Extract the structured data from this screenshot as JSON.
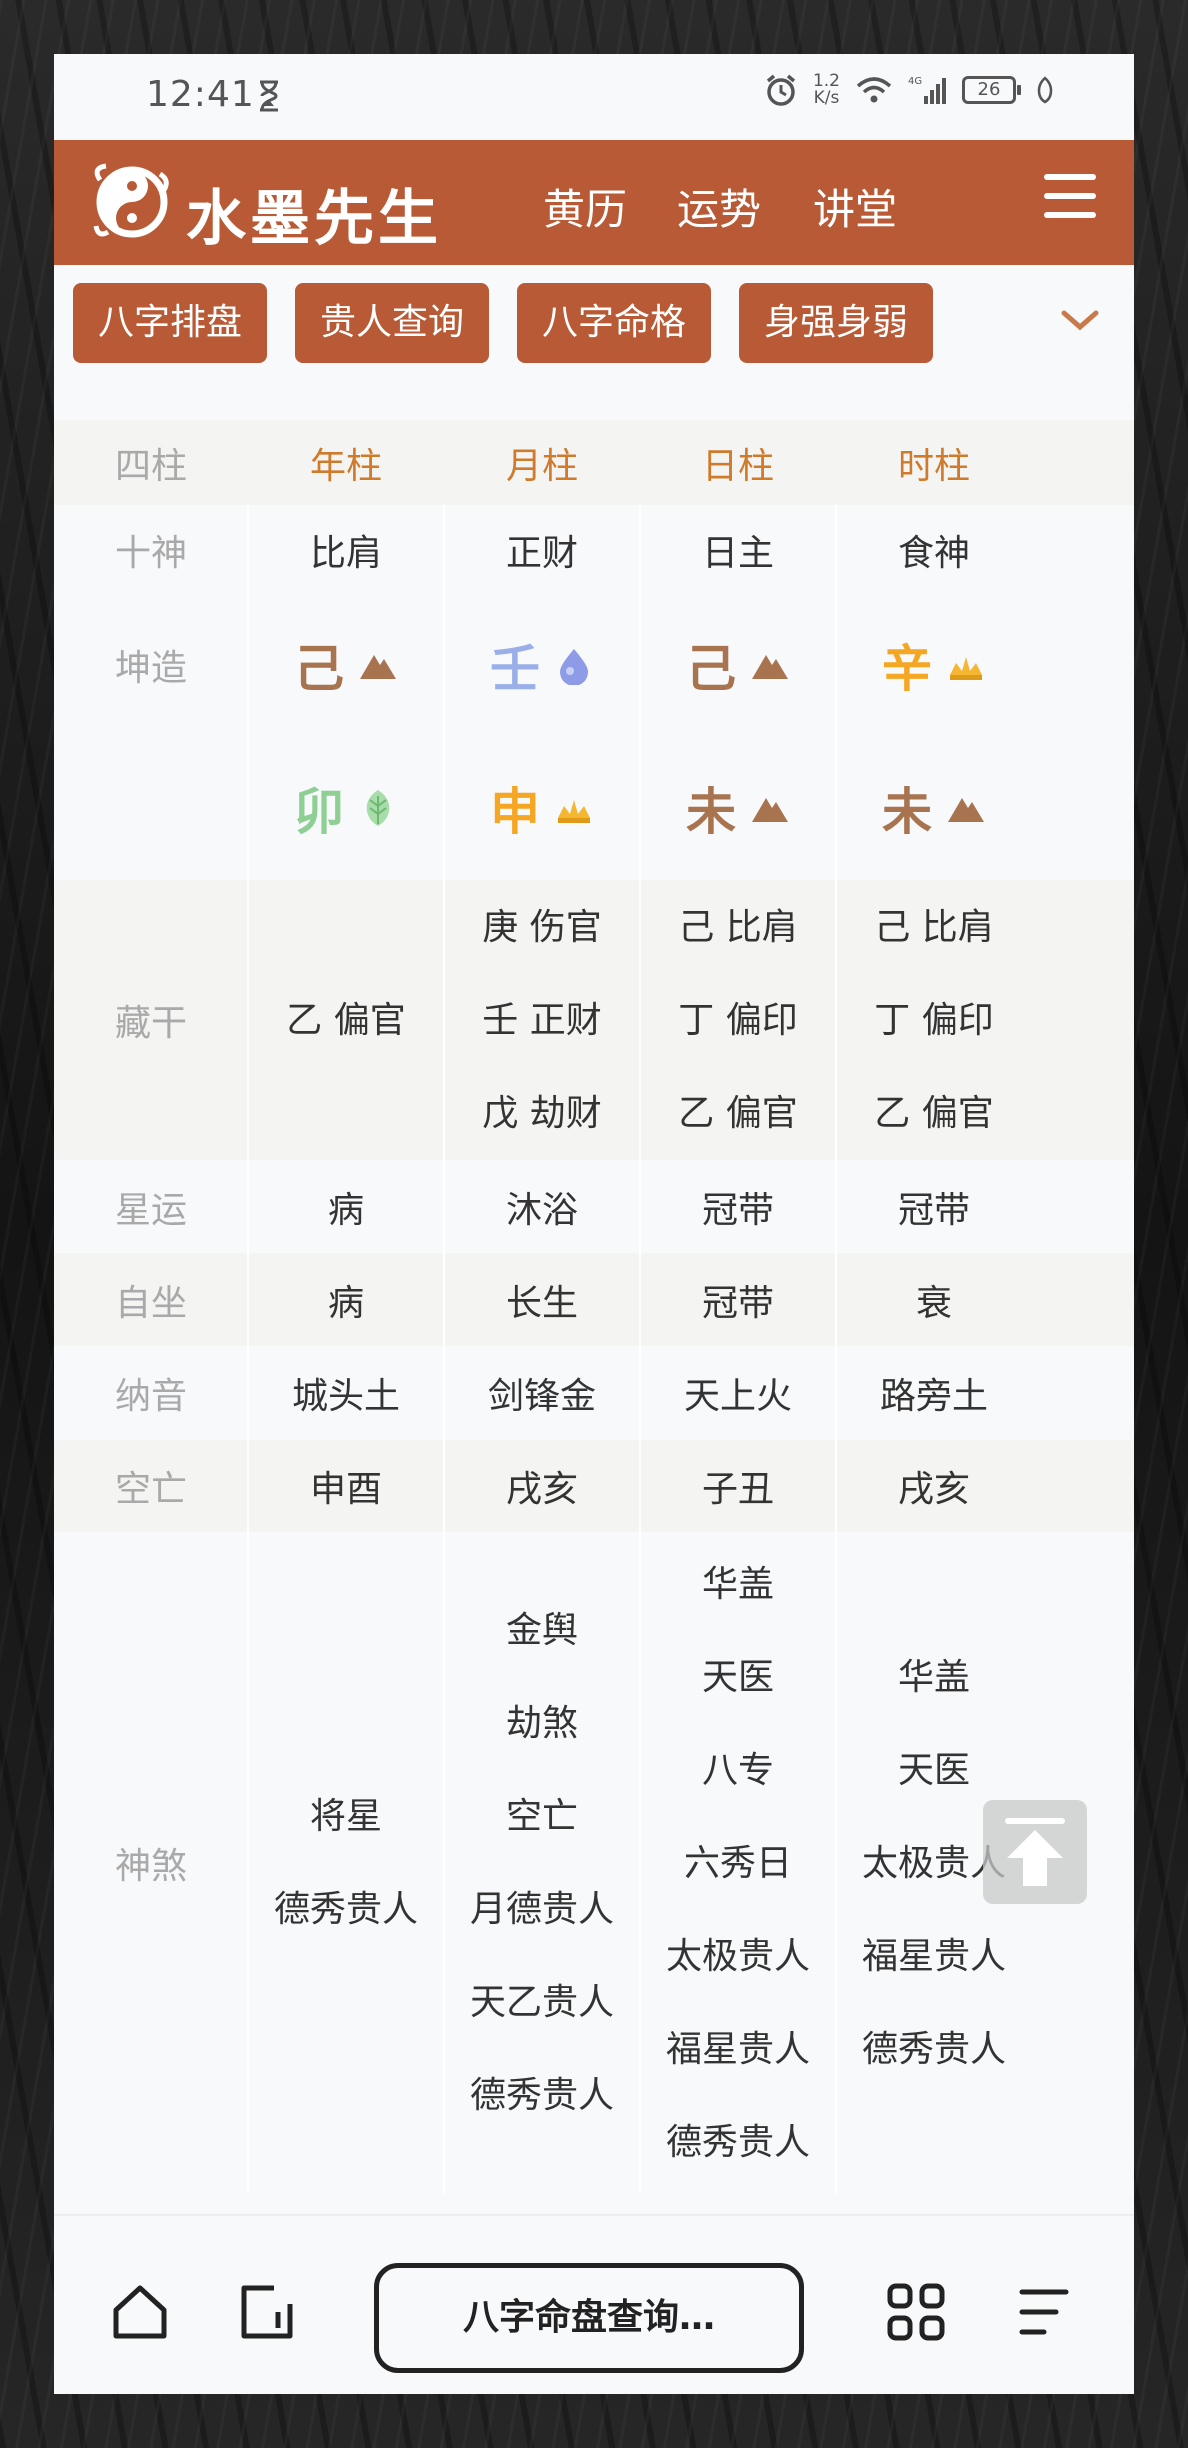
{
  "status_bar": {
    "time": "12:41",
    "net_speed_top": "1.2",
    "net_speed_bottom": "K/s",
    "battery": "26",
    "icons": [
      "hourglass-icon",
      "alarm-icon",
      "wifi-icon",
      "signal-4g-icon",
      "battery-icon",
      "leaf-icon"
    ]
  },
  "header": {
    "logo_text": "水墨先生",
    "nav": [
      "黄历",
      "运势",
      "讲堂"
    ],
    "brand_color": "#b85a36"
  },
  "tabs": [
    "八字排盘",
    "贵人查询",
    "八字命格",
    "身强身弱"
  ],
  "table": {
    "row_labels": {
      "pillars": "四柱",
      "ten_gods": "十神",
      "chart": "坤造",
      "hidden_stems": "藏干",
      "star_fortune": "星运",
      "self_seat": "自坐",
      "nayin": "纳音",
      "void": "空亡",
      "shensha": "神煞"
    },
    "columns": [
      {
        "head": "年柱",
        "ten_god": "比肩",
        "stem": "己",
        "stem_color": "#a8744f",
        "stem_element": "earth-icon",
        "branch": "卯",
        "branch_color": "#8fcf94",
        "branch_element": "leaf-icon",
        "hidden": [
          "乙 偏官"
        ],
        "star": "病",
        "seat": "病",
        "nayin": "城头土",
        "void": "申酉",
        "shensha": [
          "将星",
          "德秀贵人"
        ]
      },
      {
        "head": "月柱",
        "ten_god": "正财",
        "stem": "壬",
        "stem_color": "#9aaee8",
        "stem_element": "water-drop-icon",
        "branch": "申",
        "branch_color": "#f5a623",
        "branch_element": "gold-icon",
        "hidden": [
          "庚 伤官",
          "壬 正财",
          "戊 劫财"
        ],
        "star": "沐浴",
        "seat": "长生",
        "nayin": "剑锋金",
        "void": "戌亥",
        "shensha": [
          "金舆",
          "劫煞",
          "空亡",
          "月德贵人",
          "天乙贵人",
          "德秀贵人"
        ]
      },
      {
        "head": "日柱",
        "ten_god": "日主",
        "stem": "己",
        "stem_color": "#a8744f",
        "stem_element": "earth-icon",
        "branch": "未",
        "branch_color": "#a8744f",
        "branch_element": "earth-icon",
        "hidden": [
          "己 比肩",
          "丁 偏印",
          "乙 偏官"
        ],
        "star": "冠带",
        "seat": "冠带",
        "nayin": "天上火",
        "void": "子丑",
        "shensha": [
          "华盖",
          "天医",
          "八专",
          "六秀日",
          "太极贵人",
          "福星贵人",
          "德秀贵人"
        ]
      },
      {
        "head": "时柱",
        "ten_god": "食神",
        "stem": "辛",
        "stem_color": "#f5a623",
        "stem_element": "gold-icon",
        "branch": "未",
        "branch_color": "#a8744f",
        "branch_element": "earth-icon",
        "hidden": [
          "己 比肩",
          "丁 偏印",
          "乙 偏官"
        ],
        "star": "冠带",
        "seat": "衰",
        "nayin": "路旁土",
        "void": "戌亥",
        "shensha": [
          "华盖",
          "天医",
          "太极贵人",
          "福星贵人",
          "德秀贵人"
        ]
      }
    ]
  },
  "bottom_bar": {
    "url": "八字命盘查询…",
    "icons": [
      "home-icon",
      "tabs-icon",
      "apps-icon",
      "menu-icon"
    ]
  }
}
